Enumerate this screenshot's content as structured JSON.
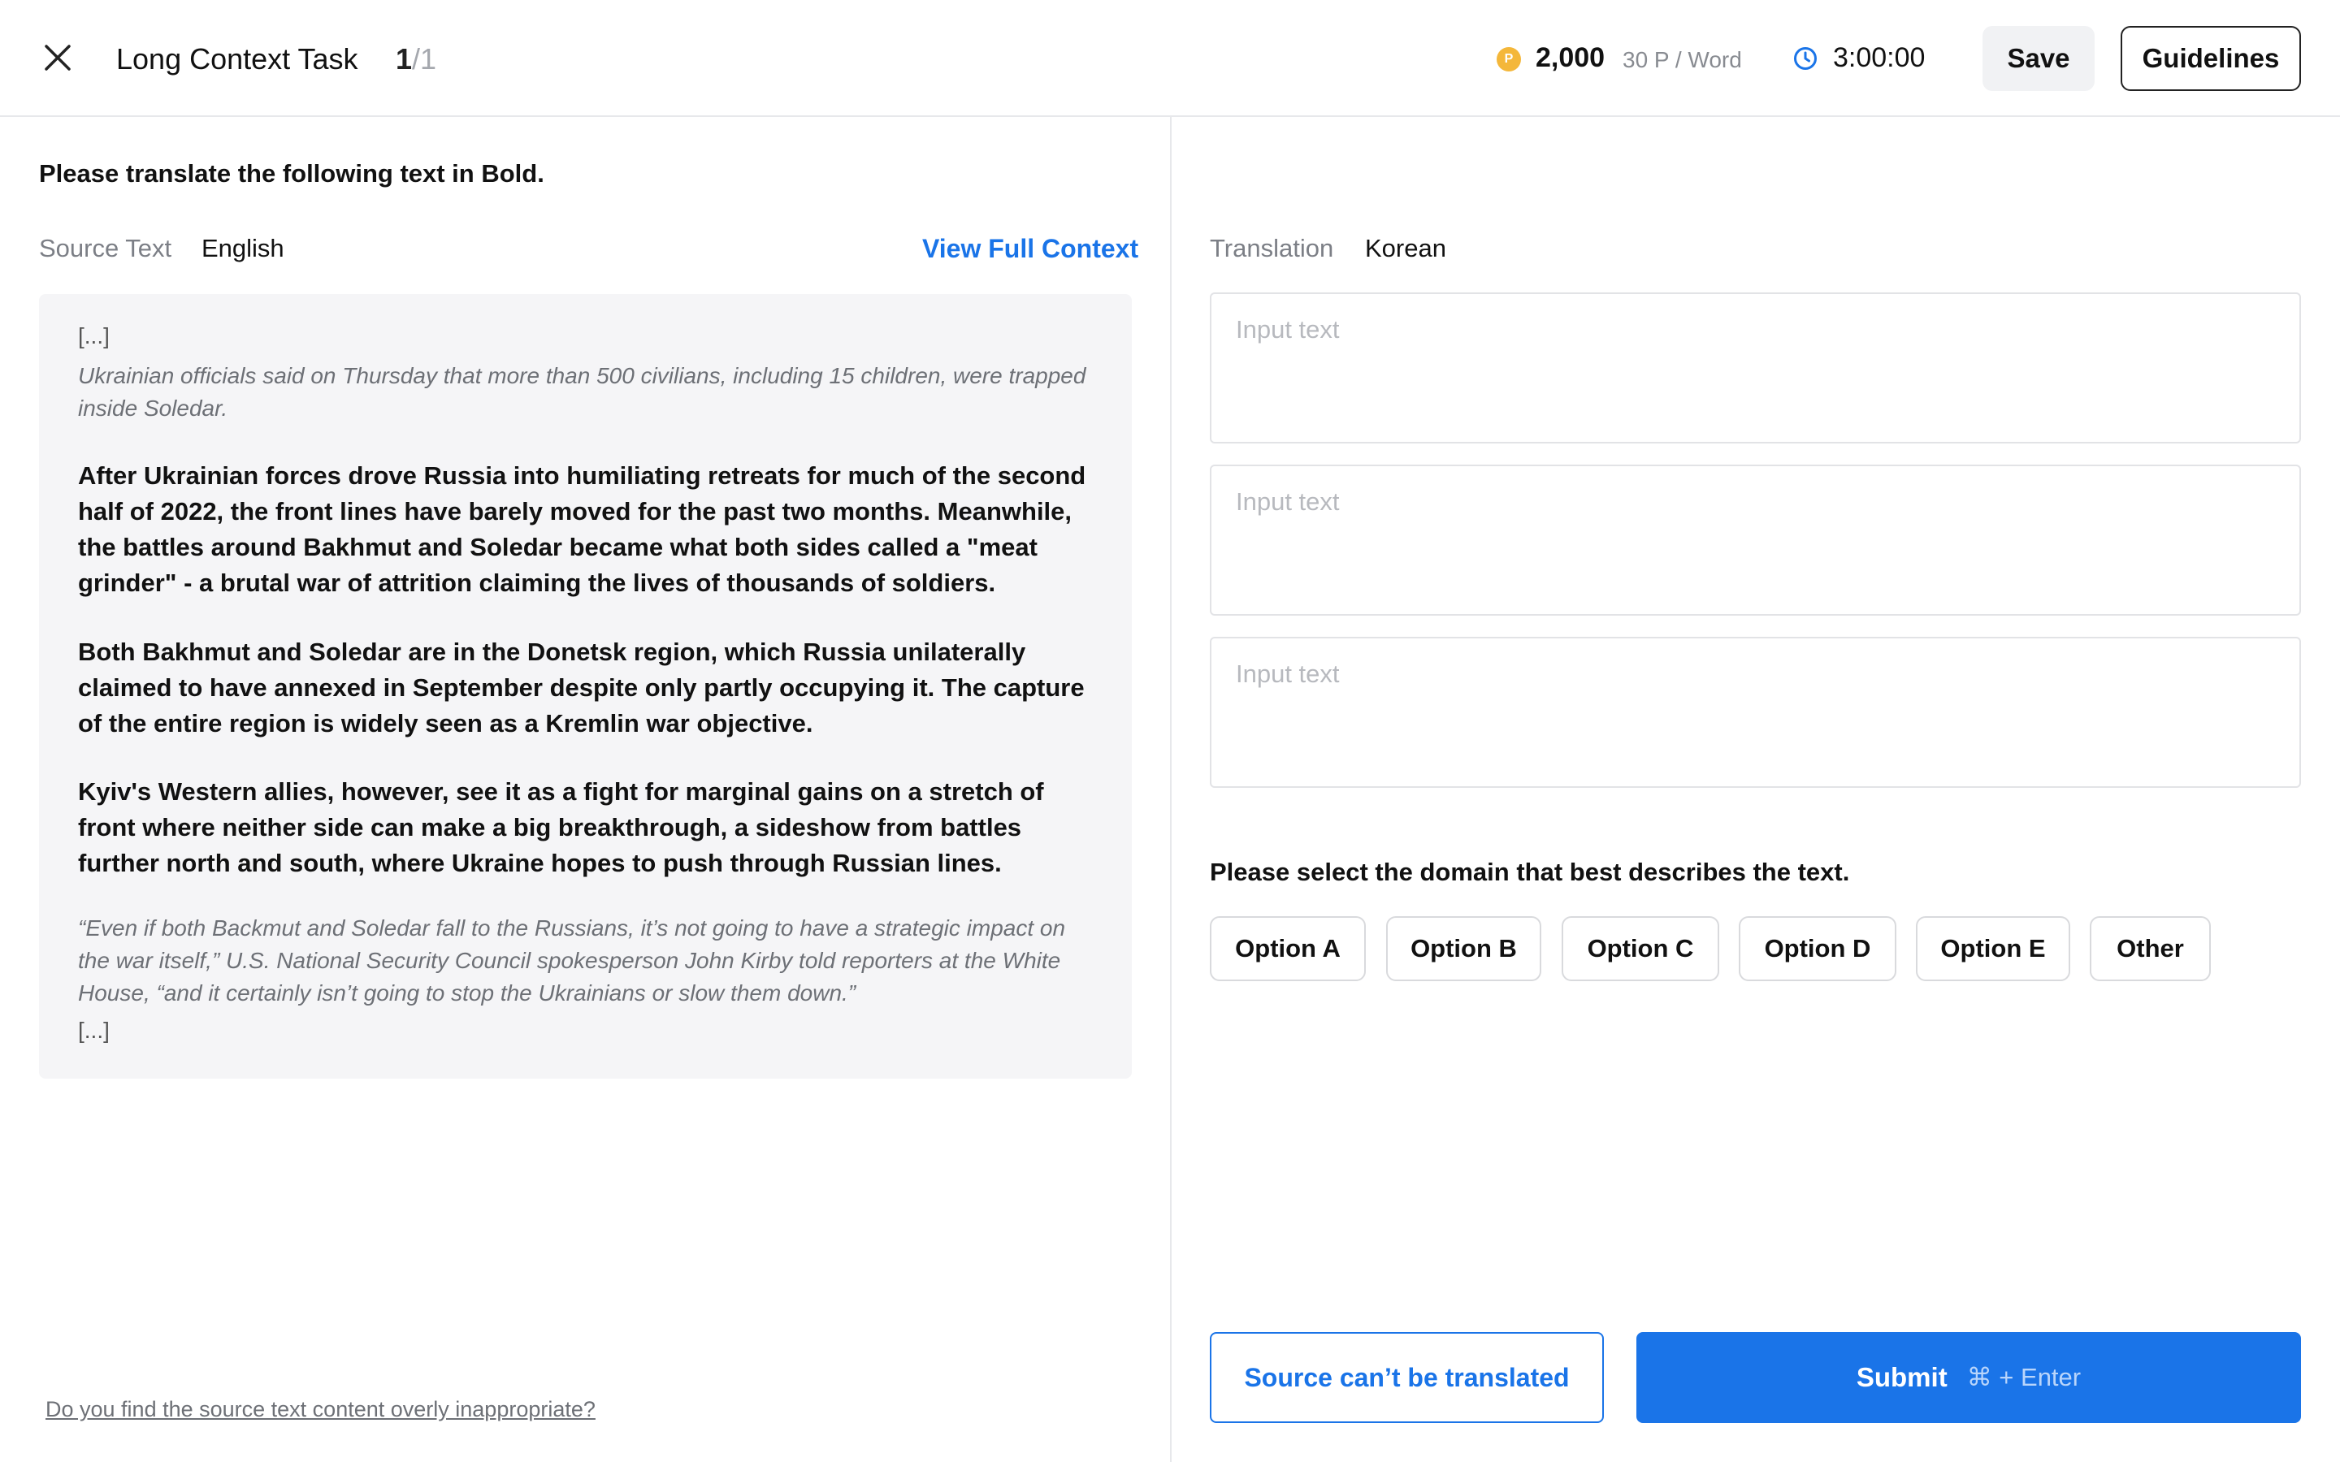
{
  "header": {
    "close_icon": "close-icon",
    "title": "Long Context Task",
    "counter_current": "1",
    "counter_total": "/1",
    "coin_glyph": "P",
    "points": "2,000",
    "rate": "30 P / Word",
    "timer": "3:00:00",
    "save_label": "Save",
    "guidelines_label": "Guidelines"
  },
  "source": {
    "instruction": "Please translate the following text in Bold.",
    "label": "Source Text",
    "language": "English",
    "view_full_context": "View Full Context",
    "ellipsis_top": "[...]",
    "context_before": "Ukrainian officials said on Thursday that more than 500 civilians, including 15 children, were trapped inside Soledar.",
    "paragraphs": [
      "After Ukrainian forces drove Russia into humiliating retreats for much of the second half of 2022, the front lines have barely moved for the past two months. Meanwhile, the battles around Bakhmut and Soledar became what both sides called a \"meat grinder\" - a brutal war of attrition claiming the lives of thousands of soldiers.",
      "Both Bakhmut and Soledar are in the Donetsk region, which Russia unilaterally claimed to have annexed in September despite only partly occupying it. The capture of the entire region is widely seen as a Kremlin war objective.",
      "Kyiv's Western allies, however, see it as a fight for marginal gains on a stretch of front where neither side can make a big breakthrough, a sideshow from battles further north and south, where Ukraine hopes to push through Russian lines."
    ],
    "context_after": "“Even if both Backmut and Soledar fall to the Russians, it’s not going to have a strategic impact on the war itself,” U.S. National Security Council spokesperson John Kirby told reporters at the White House, “and it certainly isn’t going to stop the Ukrainians or slow them down.”",
    "ellipsis_bottom": "[...]",
    "report_link": "Do you find the source text content overly inappropriate?"
  },
  "translation": {
    "label": "Translation",
    "language": "Korean",
    "inputs": [
      {
        "value": "",
        "placeholder": "Input text"
      },
      {
        "value": "",
        "placeholder": "Input text"
      },
      {
        "value": "",
        "placeholder": "Input text"
      }
    ]
  },
  "domain": {
    "question": "Please select the domain that best describes the text.",
    "options": [
      "Option A",
      "Option B",
      "Option C",
      "Option D",
      "Option E",
      "Other"
    ]
  },
  "footer": {
    "cant_translate_label": "Source can’t be translated",
    "submit_label": "Submit",
    "submit_shortcut": "⌘ + Enter"
  },
  "colors": {
    "accent": "#1a74e8",
    "coin": "#f4b73a",
    "source_bg": "#f5f5f7"
  }
}
